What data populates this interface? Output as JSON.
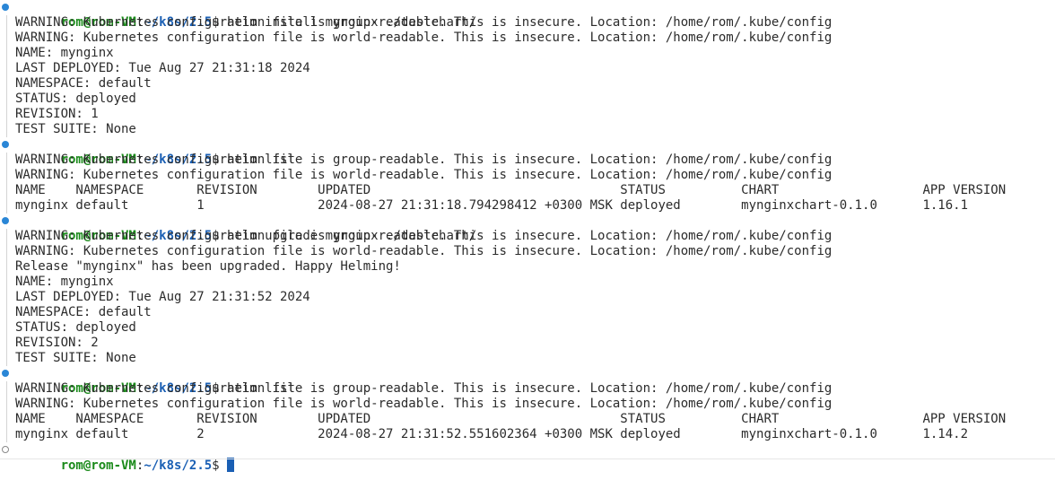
{
  "prompt": {
    "user_host": "rom@rom-VM",
    "colon": ":",
    "path": "~/k8s/2.5",
    "symbol": "$ "
  },
  "colors": {
    "user_host": "#1a8a1a",
    "path": "#1a5fb4",
    "marker_done": "#2a86d6",
    "cursor": "#1a5fb4"
  },
  "blocks": [
    {
      "command": "helm install mynginx ./testchart/",
      "output": [
        "WARNING: Kubernetes configuration file is group-readable. This is insecure. Location: /home/rom/.kube/config",
        "WARNING: Kubernetes configuration file is world-readable. This is insecure. Location: /home/rom/.kube/config",
        "NAME: mynginx",
        "LAST DEPLOYED: Tue Aug 27 21:31:18 2024",
        "NAMESPACE: default",
        "STATUS: deployed",
        "REVISION: 1",
        "TEST SUITE: None"
      ]
    },
    {
      "command": "helm list",
      "output": [
        "WARNING: Kubernetes configuration file is group-readable. This is insecure. Location: /home/rom/.kube/config",
        "WARNING: Kubernetes configuration file is world-readable. This is insecure. Location: /home/rom/.kube/config",
        "NAME   \tNAMESPACE\tREVISION\tUPDATED                                \tSTATUS  \tCHART              \tAPP VERSION",
        "mynginx\tdefault  \t1       \t2024-08-27 21:31:18.794298412 +0300 MSK\tdeployed\tmynginxchart-0.1.0 \t1.16.1"
      ]
    },
    {
      "command": "helm upgrade mynginx ./testchart/",
      "output": [
        "WARNING: Kubernetes configuration file is group-readable. This is insecure. Location: /home/rom/.kube/config",
        "WARNING: Kubernetes configuration file is world-readable. This is insecure. Location: /home/rom/.kube/config",
        "Release \"mynginx\" has been upgraded. Happy Helming!",
        "NAME: mynginx",
        "LAST DEPLOYED: Tue Aug 27 21:31:52 2024",
        "NAMESPACE: default",
        "STATUS: deployed",
        "REVISION: 2",
        "TEST SUITE: None"
      ]
    },
    {
      "command": "helm list",
      "output": [
        "WARNING: Kubernetes configuration file is group-readable. This is insecure. Location: /home/rom/.kube/config",
        "WARNING: Kubernetes configuration file is world-readable. This is insecure. Location: /home/rom/.kube/config",
        "NAME   \tNAMESPACE\tREVISION\tUPDATED                                \tSTATUS  \tCHART              \tAPP VERSION",
        "mynginx\tdefault  \t2       \t2024-08-27 21:31:52.551602364 +0300 MSK\tdeployed\tmynginxchart-0.1.0 \t1.14.2"
      ]
    }
  ]
}
